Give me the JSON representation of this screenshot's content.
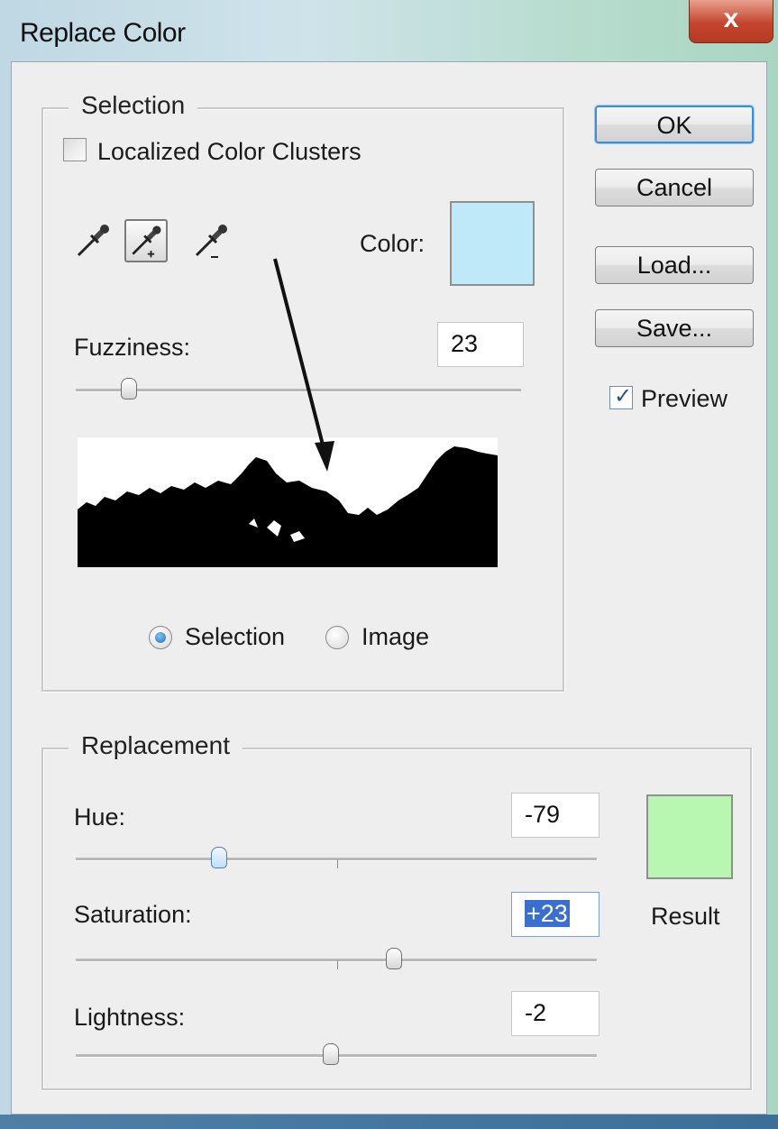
{
  "window": {
    "title": "Replace Color",
    "close_symbol": "x"
  },
  "selection": {
    "legend": "Selection",
    "localized_label": "Localized Color Clusters",
    "localized_checked": false,
    "color_label": "Color:",
    "color_value": "#bfe8f8",
    "fuzziness_label": "Fuzziness:",
    "fuzziness_value": "23",
    "view_selection_label": "Selection",
    "view_image_label": "Image",
    "view_selected": "Selection"
  },
  "replacement": {
    "legend": "Replacement",
    "hue_label": "Hue:",
    "hue_value": "-79",
    "saturation_label": "Saturation:",
    "saturation_value": "+23",
    "lightness_label": "Lightness:",
    "lightness_value": "-2",
    "result_label": "Result",
    "result_color": "#b8f7b1"
  },
  "buttons": {
    "ok": "OK",
    "cancel": "Cancel",
    "load": "Load...",
    "save": "Save..."
  },
  "preview": {
    "label": "Preview",
    "checked": true
  },
  "icons": [
    "eyedropper-icon",
    "eyedropper-plus-icon",
    "eyedropper-minus-icon"
  ]
}
